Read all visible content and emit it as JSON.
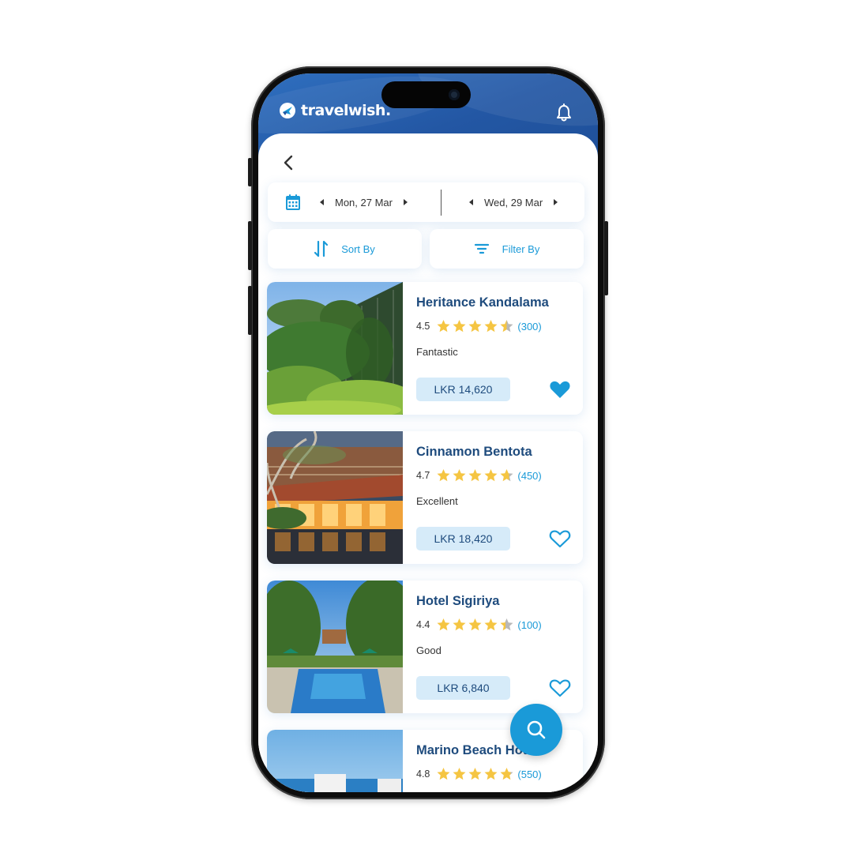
{
  "app": {
    "brand": "travelwish."
  },
  "header": {
    "notification_icon": "bell-icon"
  },
  "nav": {
    "back_icon": "chevron-left-icon"
  },
  "dates": {
    "check_in": "Mon, 27 Mar",
    "check_out": "Wed, 29 Mar",
    "icon": "calendar-icon"
  },
  "controls": {
    "sort_label": "Sort By",
    "filter_label": "Filter By"
  },
  "hotels": [
    {
      "name": "Heritance Kandalama",
      "score": "4.5",
      "stars": 4.5,
      "reviews": "(300)",
      "verdict": "Fantastic",
      "price": "LKR 14,620",
      "favorite": true
    },
    {
      "name": "Cinnamon Bentota",
      "score": "4.7",
      "stars": 4.7,
      "reviews": "(450)",
      "verdict": "Excellent",
      "price": "LKR 18,420",
      "favorite": false
    },
    {
      "name": "Hotel Sigiriya",
      "score": "4.4",
      "stars": 4.4,
      "reviews": "(100)",
      "verdict": "Good",
      "price": "LKR 6,840",
      "favorite": false
    },
    {
      "name": "Marino Beach Hotel",
      "score": "4.8",
      "stars": 4.8,
      "reviews": "(550)",
      "verdict": "",
      "price": "",
      "favorite": false
    }
  ],
  "colors": {
    "accent": "#1a9ad8",
    "header": "#2357a4",
    "title": "#1e4b7d",
    "star": "#f5c542",
    "star_empty": "#b8b8b8"
  },
  "fab": {
    "icon": "search-icon"
  }
}
